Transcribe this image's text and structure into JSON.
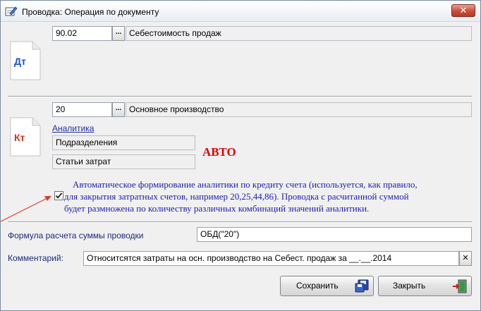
{
  "window": {
    "title": "Проводка: Операция по документу"
  },
  "debit": {
    "icon_text": "Дт",
    "account_code": "90.02",
    "account_name": "Себестоимость продаж",
    "lookup_label": "..."
  },
  "credit": {
    "icon_text": "Кт",
    "account_code": "20",
    "account_name": "Основное производство",
    "lookup_label": "...",
    "analytics_link": "Аналитика",
    "analytics": [
      "Подразделения",
      "Статьи затрат"
    ],
    "auto_label": "АВТО"
  },
  "auto_analytics": {
    "checked": true,
    "text_line1": "Автоматическое формирование аналитики по кредиту счета (используется, как правило,",
    "text_line2": "для закрытия затратных счетов, например 20,25,44,86). Проводка с расчитанной суммой",
    "text_line3": "будет размножена по количеству различных комбинаций значений аналитики."
  },
  "formula": {
    "label": "Формула расчета суммы проводки",
    "value": "ОБД(\"20\")"
  },
  "comment": {
    "label": "Комментарий:",
    "value": "Относитсятся затраты на осн. производство на Себест. продаж за  __.__.2014",
    "clear_label": "✕"
  },
  "buttons": {
    "save": "Сохранить",
    "close": "Закрыть"
  },
  "close_glyph": "✕",
  "colors": {
    "accent_red": "#e00000",
    "link_blue": "#1b2fa8",
    "text_blue": "#1c1cb4"
  }
}
